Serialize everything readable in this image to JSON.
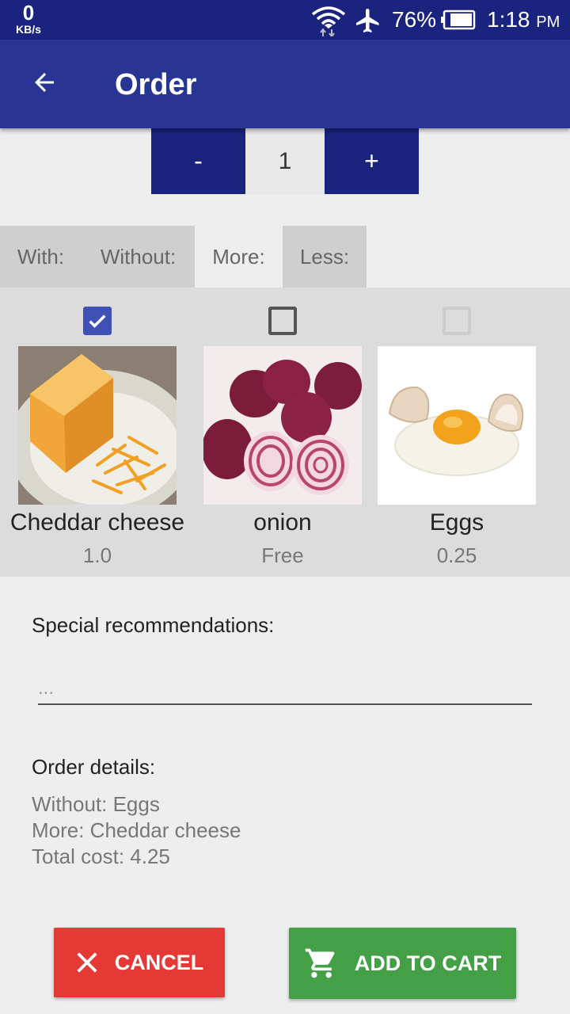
{
  "status_bar": {
    "net_speed_value": "0",
    "net_speed_unit": "KB/s",
    "battery_percent": "76%",
    "time": "1:18",
    "ampm": "PM"
  },
  "app_bar": {
    "title": "Order",
    "back_icon": "arrow-back-icon"
  },
  "quantity": {
    "decrement_label": "-",
    "value": "1",
    "increment_label": "+"
  },
  "tabs": [
    {
      "label": "With:",
      "active": false
    },
    {
      "label": "Without:",
      "active": false
    },
    {
      "label": "More:",
      "active": true
    },
    {
      "label": "Less:",
      "active": false
    }
  ],
  "ingredients": [
    {
      "name": "Cheddar cheese",
      "price": "1.0",
      "checked": true,
      "enabled": true
    },
    {
      "name": "onion",
      "price": "Free",
      "checked": false,
      "enabled": true
    },
    {
      "name": "Eggs",
      "price": "0.25",
      "checked": false,
      "enabled": false
    }
  ],
  "special": {
    "label": "Special recommendations:",
    "placeholder": "..."
  },
  "order_details": {
    "label": "Order details:",
    "lines": [
      "Without: Eggs",
      "More: Cheddar cheese",
      "Total cost: 4.25"
    ]
  },
  "buttons": {
    "cancel": {
      "label": "CANCEL",
      "icon": "close-icon"
    },
    "add_to_cart": {
      "label": "ADD TO CART",
      "icon": "cart-icon"
    }
  },
  "colors": {
    "status_bar": "#1a237e",
    "app_bar": "#283593",
    "stepper": "#1a237e",
    "checkbox_checked": "#3f51b5",
    "cancel": "#e53935",
    "add_to_cart": "#43a047"
  }
}
